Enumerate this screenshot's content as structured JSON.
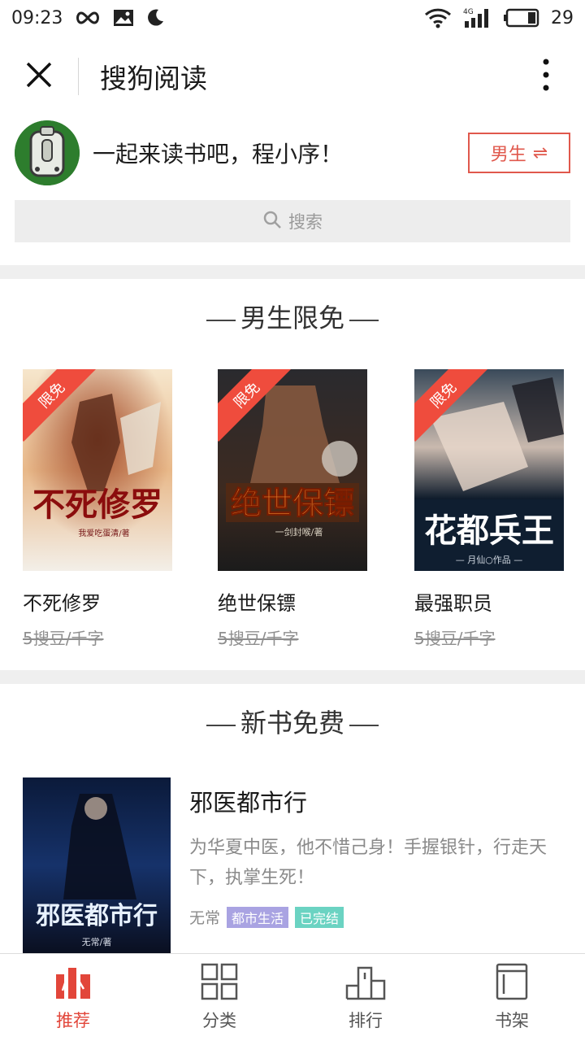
{
  "status_bar": {
    "time": "09:23",
    "battery": "29",
    "network": "4G"
  },
  "app_bar": {
    "title": "搜狗阅读"
  },
  "greeting": {
    "text": "一起来读书吧，程小序！",
    "gender_label": "男生",
    "gender_switch_symbol": "⇌"
  },
  "search": {
    "placeholder": "搜索"
  },
  "sections": {
    "free_limited": {
      "title": "男生限免",
      "badge": "限免",
      "books": [
        {
          "title": "不死修罗",
          "price": "5搜豆/千字",
          "cover_text": "不死修罗",
          "cover_author": "我爱吃蛋清/著"
        },
        {
          "title": "绝世保镖",
          "price": "5搜豆/千字",
          "cover_text": "绝世保镖",
          "cover_author": "一剑封喉/著"
        },
        {
          "title": "最强职员",
          "price": "5搜豆/千字",
          "cover_text": "花都兵王",
          "cover_author": "— 月仙○作品 —"
        }
      ]
    },
    "new_free": {
      "title": "新书免费",
      "book": {
        "title": "邪医都市行",
        "description": "为华夏中医，他不惜己身！手握银针，行走天下，执掌生死！",
        "author": "无常",
        "tags": [
          "都市生活",
          "已完结"
        ],
        "cover_text": "邪医都市行",
        "cover_author": "无常/著"
      }
    }
  },
  "tabs": [
    {
      "label": "推荐",
      "icon": "recommend-icon",
      "active": true
    },
    {
      "label": "分类",
      "icon": "category-grid-icon",
      "active": false
    },
    {
      "label": "排行",
      "icon": "ranking-icon",
      "active": false
    },
    {
      "label": "书架",
      "icon": "bookshelf-icon",
      "active": false
    }
  ],
  "colors": {
    "accent": "#e2463a",
    "tag_purple": "#a9a3e2",
    "tag_green": "#6bd3c2"
  }
}
